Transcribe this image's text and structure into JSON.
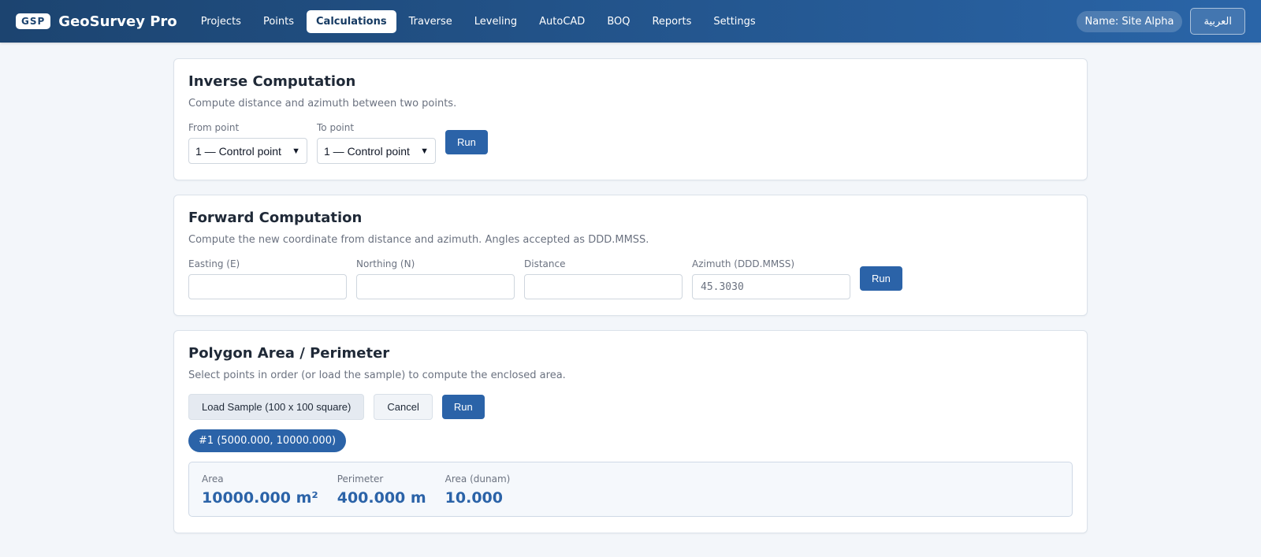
{
  "brand": {
    "badge": "GSP",
    "name": "GeoSurvey Pro"
  },
  "nav": {
    "items": [
      {
        "label": "Projects",
        "active": false
      },
      {
        "label": "Points",
        "active": false
      },
      {
        "label": "Calculations",
        "active": true
      },
      {
        "label": "Traverse",
        "active": false
      },
      {
        "label": "Leveling",
        "active": false
      },
      {
        "label": "AutoCAD",
        "active": false
      },
      {
        "label": "BOQ",
        "active": false
      },
      {
        "label": "Reports",
        "active": false
      },
      {
        "label": "Settings",
        "active": false
      }
    ]
  },
  "header": {
    "project_name": "Name: Site Alpha",
    "language_button": "العربية"
  },
  "inverse": {
    "title": "Inverse Computation",
    "description": "Compute distance and azimuth between two points.",
    "from_label": "From point",
    "from_value": "1 — Control point",
    "to_label": "To point",
    "to_value": "1 — Control point",
    "run_label": "Run"
  },
  "forward": {
    "title": "Forward Computation",
    "description": "Compute the new coordinate from distance and azimuth. Angles accepted as DDD.MMSS.",
    "easting_label": "Easting (E)",
    "easting_value": "",
    "northing_label": "Northing (N)",
    "northing_value": "",
    "distance_label": "Distance",
    "distance_value": "",
    "azimuth_label": "Azimuth (DDD.MMSS)",
    "azimuth_placeholder": "45.3030",
    "run_label": "Run"
  },
  "polygon": {
    "title": "Polygon Area / Perimeter",
    "description": "Select points in order (or load the sample) to compute the enclosed area.",
    "load_sample_label": "Load Sample (100 x 100 square)",
    "cancel_label": "Cancel",
    "run_label": "Run",
    "selected_points": [
      "#1 (5000.000, 10000.000)"
    ],
    "results": {
      "area_label": "Area",
      "area_value": "10000.000 m²",
      "perimeter_label": "Perimeter",
      "perimeter_value": "400.000 m",
      "dunam_label": "Area (dunam)",
      "dunam_value": "10.000"
    }
  },
  "colors": {
    "accent": "#2b63a8",
    "header_start": "#1c4470",
    "header_end": "#2a65a8"
  }
}
